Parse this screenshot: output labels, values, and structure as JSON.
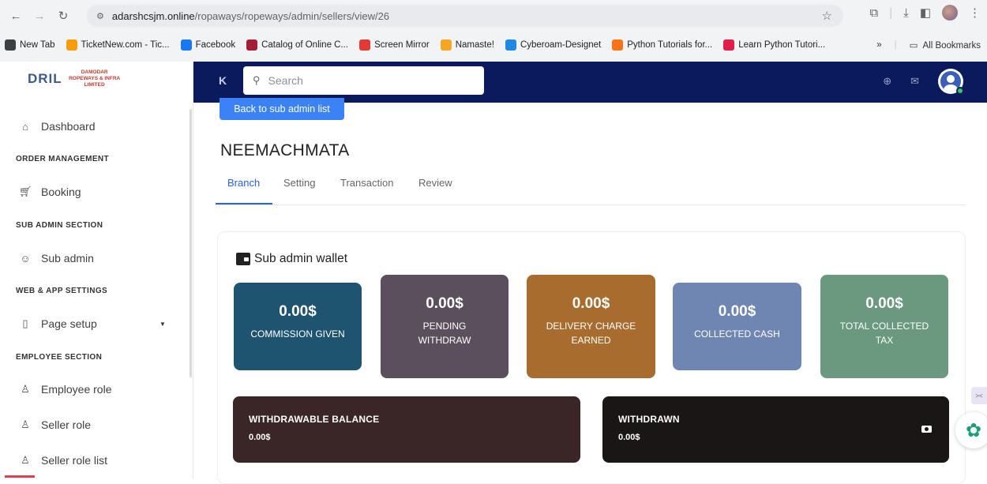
{
  "browser": {
    "url_host": "adarshcsjm.online",
    "url_path": "/ropaways/ropeways/admin/sellers/view/26",
    "bookmarks": [
      {
        "label": "New Tab",
        "color": "#3c4043",
        "icon": "globe-icon"
      },
      {
        "label": "TicketNew.com - Tic...",
        "color": "#f59e0b",
        "icon": "ticket-icon"
      },
      {
        "label": "Facebook",
        "color": "#1877f2",
        "icon": "facebook-icon"
      },
      {
        "label": "Catalog of Online C...",
        "color": "#a41e34",
        "icon": "shield-icon"
      },
      {
        "label": "Screen Mirror",
        "color": "#e53935",
        "icon": "mirror-icon"
      },
      {
        "label": "Namaste!",
        "color": "#f5a623",
        "icon": "namaste-icon"
      },
      {
        "label": "Cyberoam-Designet",
        "color": "#1e88e5",
        "icon": "cyberoam-icon"
      },
      {
        "label": "Python Tutorials for...",
        "color": "#f97316",
        "icon": "python-icon"
      },
      {
        "label": "Learn Python Tutori...",
        "color": "#e11d48",
        "icon": "v-icon"
      }
    ],
    "more_bookmarks": "»",
    "all_bookmarks": "All Bookmarks"
  },
  "sidebar": {
    "logo_text": "DRIL",
    "logo_company": "DAMODAR ROPEWAYS & INFRA LIMITED",
    "items": {
      "dashboard": "Dashboard",
      "order_management": "ORDER MANAGEMENT",
      "booking": "Booking",
      "sub_admin_section": "SUB ADMIN SECTION",
      "sub_admin": "Sub admin",
      "web_app_settings": "WEB & APP SETTINGS",
      "page_setup": "Page setup",
      "employee_section": "EMPLOYEE SECTION",
      "employee_role": "Employee role",
      "seller_role": "Seller role",
      "seller_role_list": "Seller role list"
    }
  },
  "topbar": {
    "search_placeholder": "Search"
  },
  "main": {
    "back_button": "Back to sub admin list",
    "title": "NEEMACHMATA",
    "tabs": [
      "Branch",
      "Setting",
      "Transaction",
      "Review"
    ],
    "active_tab": "Branch",
    "wallet": {
      "title": "Sub admin wallet",
      "stats": [
        {
          "value": "0.00$",
          "label": "COMMISSION GIVEN",
          "color": "#1f5470"
        },
        {
          "value": "0.00$",
          "label": "PENDING WITHDRAW",
          "color": "#5c4f5d"
        },
        {
          "value": "0.00$",
          "label": "DELIVERY CHARGE EARNED",
          "color": "#a86c2e"
        },
        {
          "value": "0.00$",
          "label": "COLLECTED CASH",
          "color": "#6f86b3"
        },
        {
          "value": "0.00$",
          "label": "TOTAL COLLECTED TAX",
          "color": "#6b9980"
        }
      ],
      "withdrawable": {
        "label": "WITHDRAWABLE BALANCE",
        "value": "0.00$",
        "color": "#3a2626"
      },
      "withdrawn": {
        "label": "WITHDRAWN",
        "value": "0.00$",
        "color": "#1b1616"
      }
    }
  }
}
